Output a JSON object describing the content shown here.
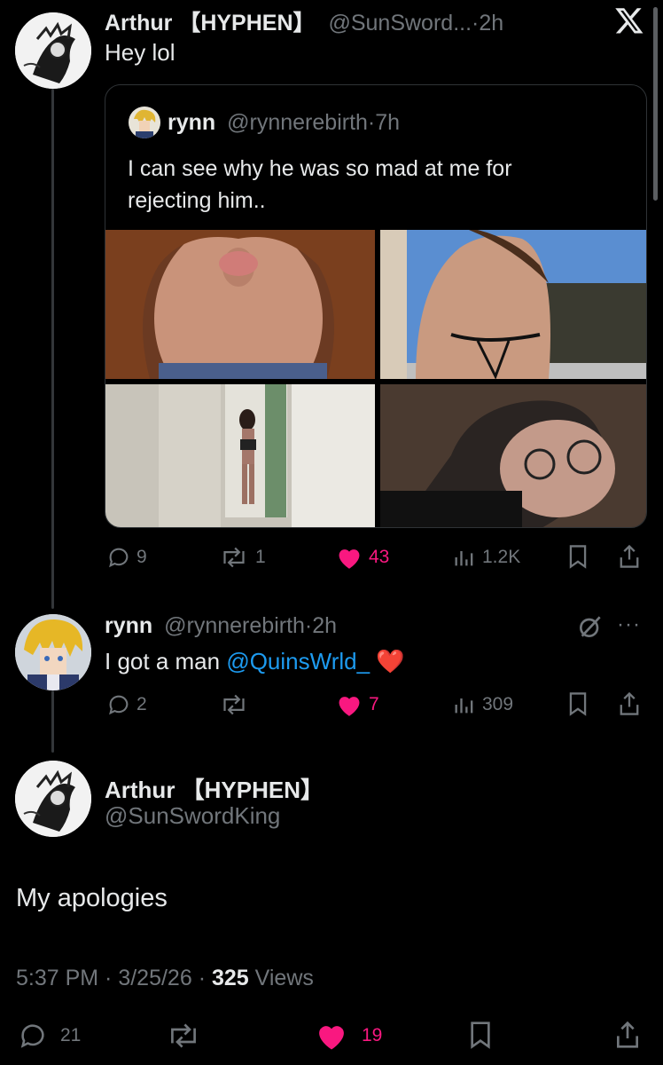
{
  "top_post": {
    "author_name": "Arthur 【HYPHEN】",
    "author_handle": "@SunSword...",
    "time": "2h",
    "text": "Hey lol",
    "quote": {
      "author_name": "rynn",
      "author_handle": "@rynnerebirth",
      "time": "7h",
      "text_line1": "I can see why he was so mad at me for",
      "text_line2": "rejecting him.."
    },
    "actions": {
      "replies": "9",
      "reposts": "1",
      "likes": "43",
      "views": "1.2K"
    }
  },
  "reply_post": {
    "author_name": "rynn",
    "author_handle": "@rynnerebirth",
    "time": "2h",
    "text_before": "I got a man",
    "mention": "@QuinsWrld_",
    "emoji": "❤️",
    "actions": {
      "replies": "2",
      "reposts": "",
      "likes": "7",
      "views": "309"
    }
  },
  "main_post": {
    "author_name": "Arthur 【HYPHEN】",
    "author_handle": "@SunSwordKing",
    "text": "My apologies",
    "time": "5:37 PM",
    "date": "3/25/26",
    "views_count": "325",
    "views_label": "Views",
    "actions": {
      "replies": "21",
      "likes": "19"
    }
  },
  "colors": {
    "accent": "#1d9bf0",
    "like": "#f91880",
    "muted": "#71767b",
    "text": "#e7e9ea"
  }
}
